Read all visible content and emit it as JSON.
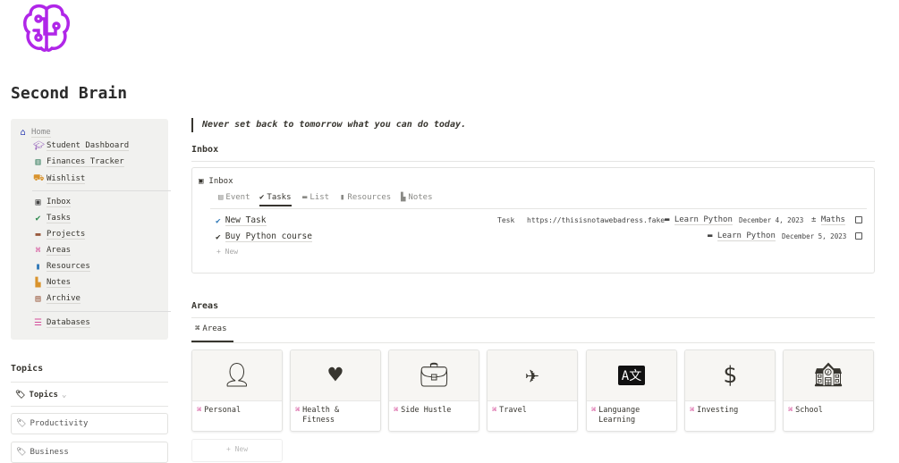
{
  "page": {
    "title": "Second Brain",
    "quote": "Never set back to tomorrow what you can do today."
  },
  "nav": {
    "home": "Home",
    "items1": [
      "Student Dashboard",
      "Finances Tracker",
      "Wishlist"
    ],
    "items2": [
      "Inbox",
      "Tasks",
      "Projects",
      "Areas",
      "Resources",
      "Notes",
      "Archive"
    ],
    "items3": [
      "Databases"
    ]
  },
  "topics": {
    "heading": "Topics",
    "view": "Topics",
    "items": [
      "Productivity",
      "Business"
    ]
  },
  "inbox": {
    "heading": "Inbox",
    "db_title": "Inbox",
    "tabs": [
      "Event",
      "Tasks",
      "List",
      "Resources",
      "Notes"
    ],
    "active_tab": "Tasks",
    "rows": [
      {
        "name": "New Task",
        "type": "Tesk",
        "url": "https://thisisnotawebadress.fake",
        "project": "Learn Python",
        "date": "December 4, 2023",
        "area": "Maths"
      },
      {
        "name": "Buy Python course",
        "project": "Learn Python",
        "date": "December 5, 2023"
      }
    ],
    "new_label": "+ New"
  },
  "areas": {
    "heading": "Areas",
    "tab": "Areas",
    "cards": [
      {
        "name": "Personal",
        "icon": "person-icon"
      },
      {
        "name": "Health & Fitness",
        "icon": "heart-pulse-icon"
      },
      {
        "name": "Side Hustle",
        "icon": "briefcase-icon"
      },
      {
        "name": "Travel",
        "icon": "airplane-icon"
      },
      {
        "name": "Languange Learning",
        "icon": "translate-icon"
      },
      {
        "name": "Investing",
        "icon": "money-plant-icon"
      },
      {
        "name": "School",
        "icon": "school-icon"
      }
    ],
    "new_label": "+ New"
  },
  "colors": {
    "logo": "#b026e8",
    "areas": "#d44c98",
    "home": "#0a1fa8"
  }
}
